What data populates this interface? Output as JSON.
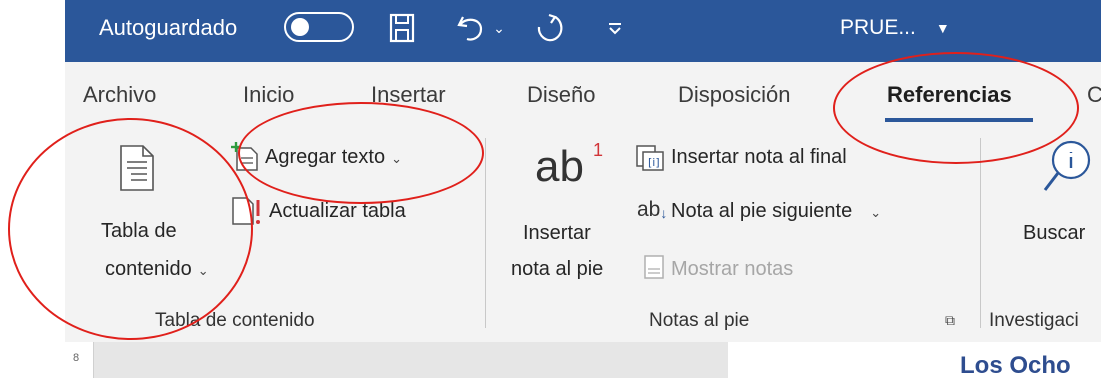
{
  "titlebar": {
    "autosave_label": "Autoguardado",
    "document_name": "PRUE...",
    "colors": {
      "background": "#2b579a"
    }
  },
  "tabs": [
    {
      "label": "Archivo"
    },
    {
      "label": "Inicio"
    },
    {
      "label": "Insertar"
    },
    {
      "label": "Diseño"
    },
    {
      "label": "Disposición"
    },
    {
      "label": "Referencias",
      "active": true
    },
    {
      "label": "C"
    }
  ],
  "groups": {
    "toc": {
      "label": "Tabla de contenido",
      "toc_button_line1": "Tabla de",
      "toc_button_line2": "contenido",
      "add_text": "Agregar texto",
      "update_table": "Actualizar tabla"
    },
    "footnotes": {
      "label": "Notas al pie",
      "insert_line1": "Insertar",
      "insert_line2": "nota al pie",
      "ab_glyph": "ab",
      "superscript": "1",
      "insert_endnote": "Insertar nota al final",
      "next_footnote": "Nota al pie siguiente",
      "show_notes": "Mostrar notas"
    },
    "research": {
      "label": "Investigaci",
      "search": "Buscar"
    }
  },
  "document": {
    "ruler_mark": "8",
    "heading_fragment": "Los Ocho"
  },
  "annotations": {
    "color": "#e0201b"
  }
}
